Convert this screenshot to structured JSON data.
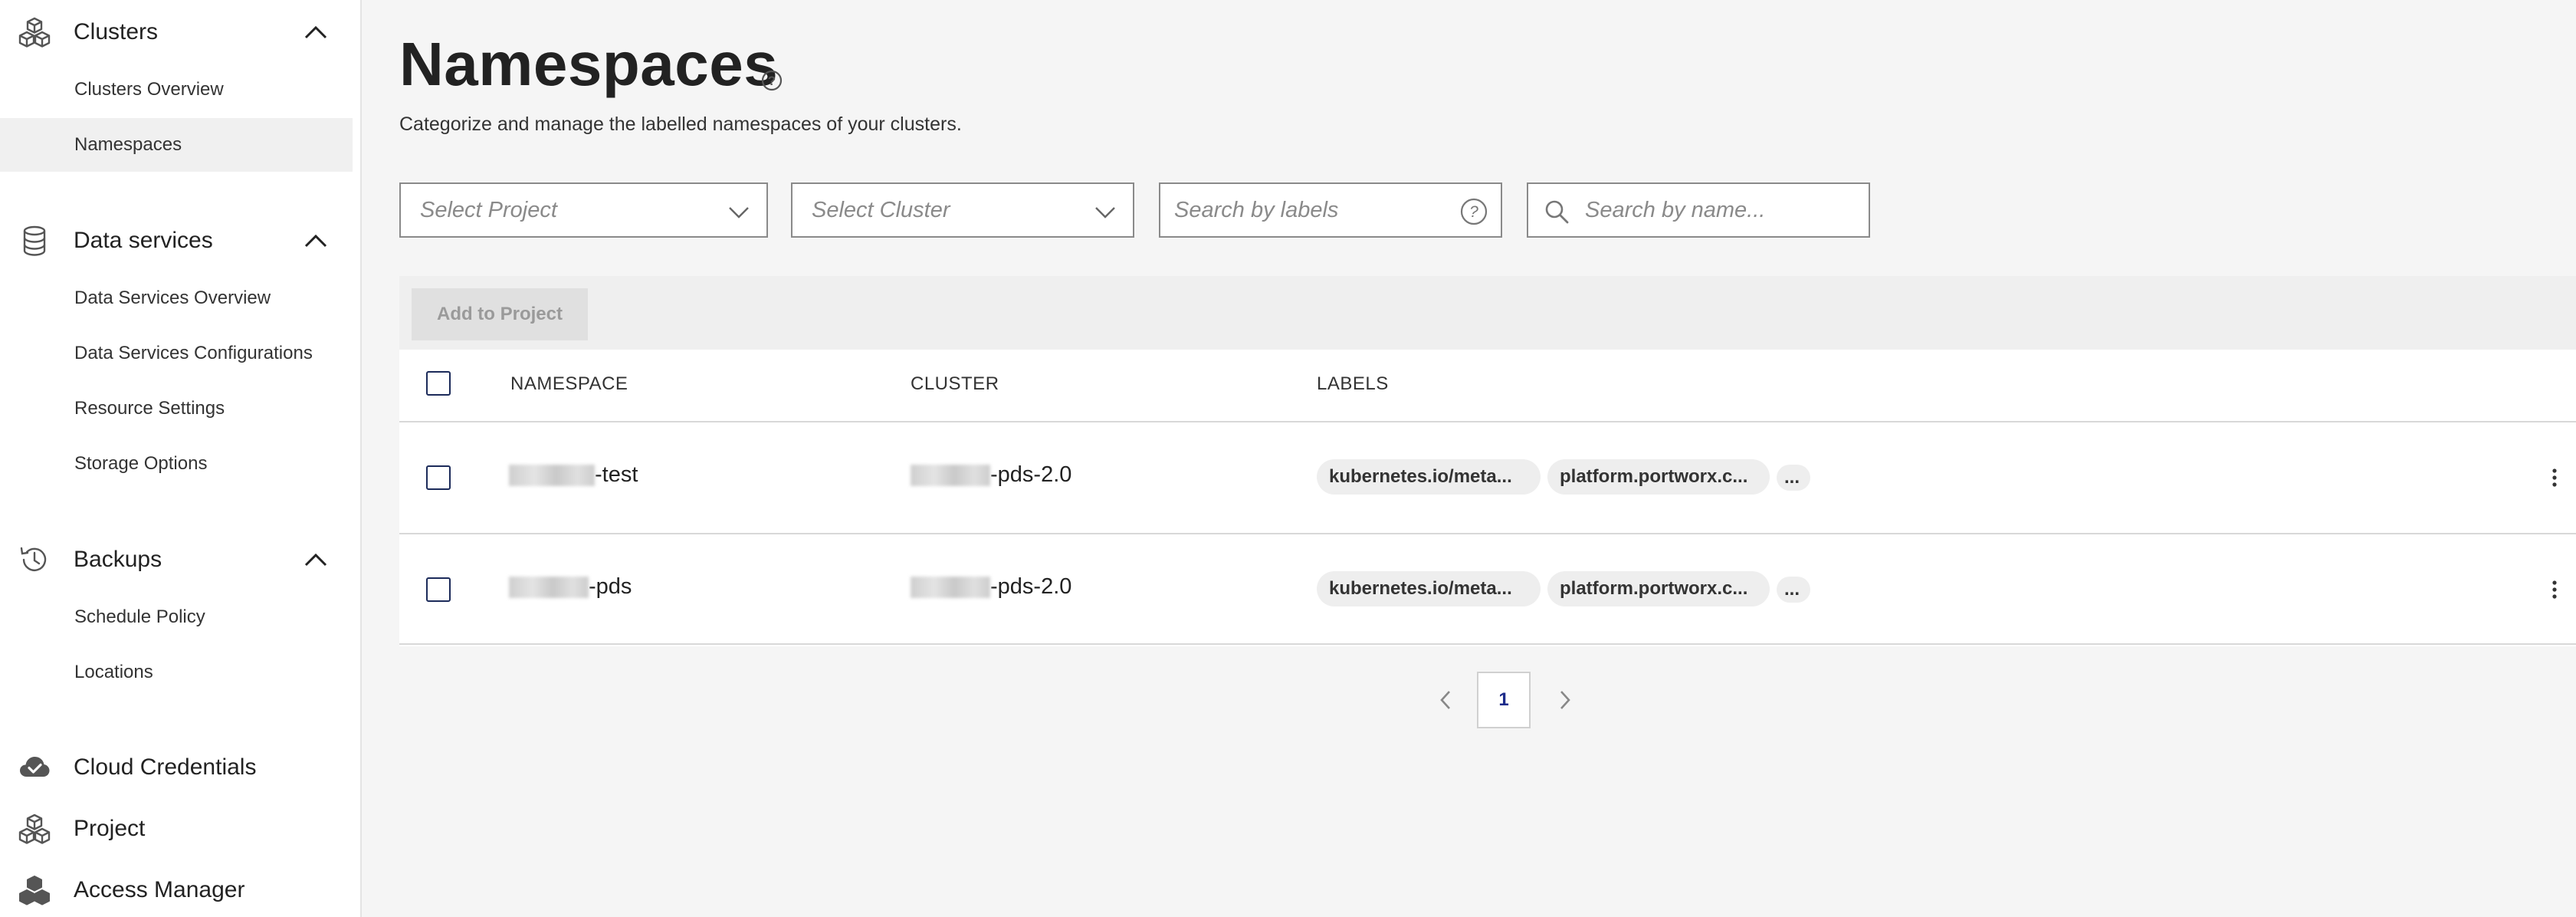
{
  "sidebar": {
    "clusters": {
      "label": "Clusters",
      "icon": "clusters-icon",
      "items": [
        {
          "label": "Clusters Overview"
        },
        {
          "label": "Namespaces",
          "active": true
        }
      ]
    },
    "data_services": {
      "label": "Data services",
      "icon": "database-icon",
      "items": [
        {
          "label": "Data Services Overview"
        },
        {
          "label": "Data Services Configurations"
        },
        {
          "label": "Resource Settings"
        },
        {
          "label": "Storage Options"
        }
      ]
    },
    "backups": {
      "label": "Backups",
      "icon": "history-icon",
      "items": [
        {
          "label": "Schedule Policy"
        },
        {
          "label": "Locations"
        }
      ]
    },
    "cloud_credentials": {
      "label": "Cloud Credentials",
      "icon": "cloud-check-icon"
    },
    "project": {
      "label": "Project",
      "icon": "cubes-icon"
    },
    "access_manager": {
      "label": "Access Manager",
      "icon": "cubes-icon"
    }
  },
  "page": {
    "title": "Namespaces",
    "subtitle": "Categorize and manage the labelled namespaces of your clusters."
  },
  "filters": {
    "project_placeholder": "Select Project",
    "cluster_placeholder": "Select Cluster",
    "labels_placeholder": "Search by labels",
    "name_placeholder": "Search by name..."
  },
  "toolbar": {
    "add_label": "Add to Project"
  },
  "table": {
    "headers": {
      "namespace": "NAMESPACE",
      "cluster": "CLUSTER",
      "labels": "LABELS"
    },
    "rows": [
      {
        "namespace_suffix": "-test",
        "cluster_suffix": "-pds-2.0",
        "labels": [
          "kubernetes.io/meta...",
          "platform.portworx.c...",
          "..."
        ]
      },
      {
        "namespace_suffix": "-pds",
        "cluster_suffix": "-pds-2.0",
        "labels": [
          "kubernetes.io/meta...",
          "platform.portworx.c...",
          "..."
        ]
      }
    ]
  },
  "pagination": {
    "current_page": "1"
  },
  "colors": {
    "accent": "#1c2b5a",
    "page_number": "#1c2b8a",
    "active_bg": "#f0f0f0",
    "border": "#8a8a8a"
  }
}
